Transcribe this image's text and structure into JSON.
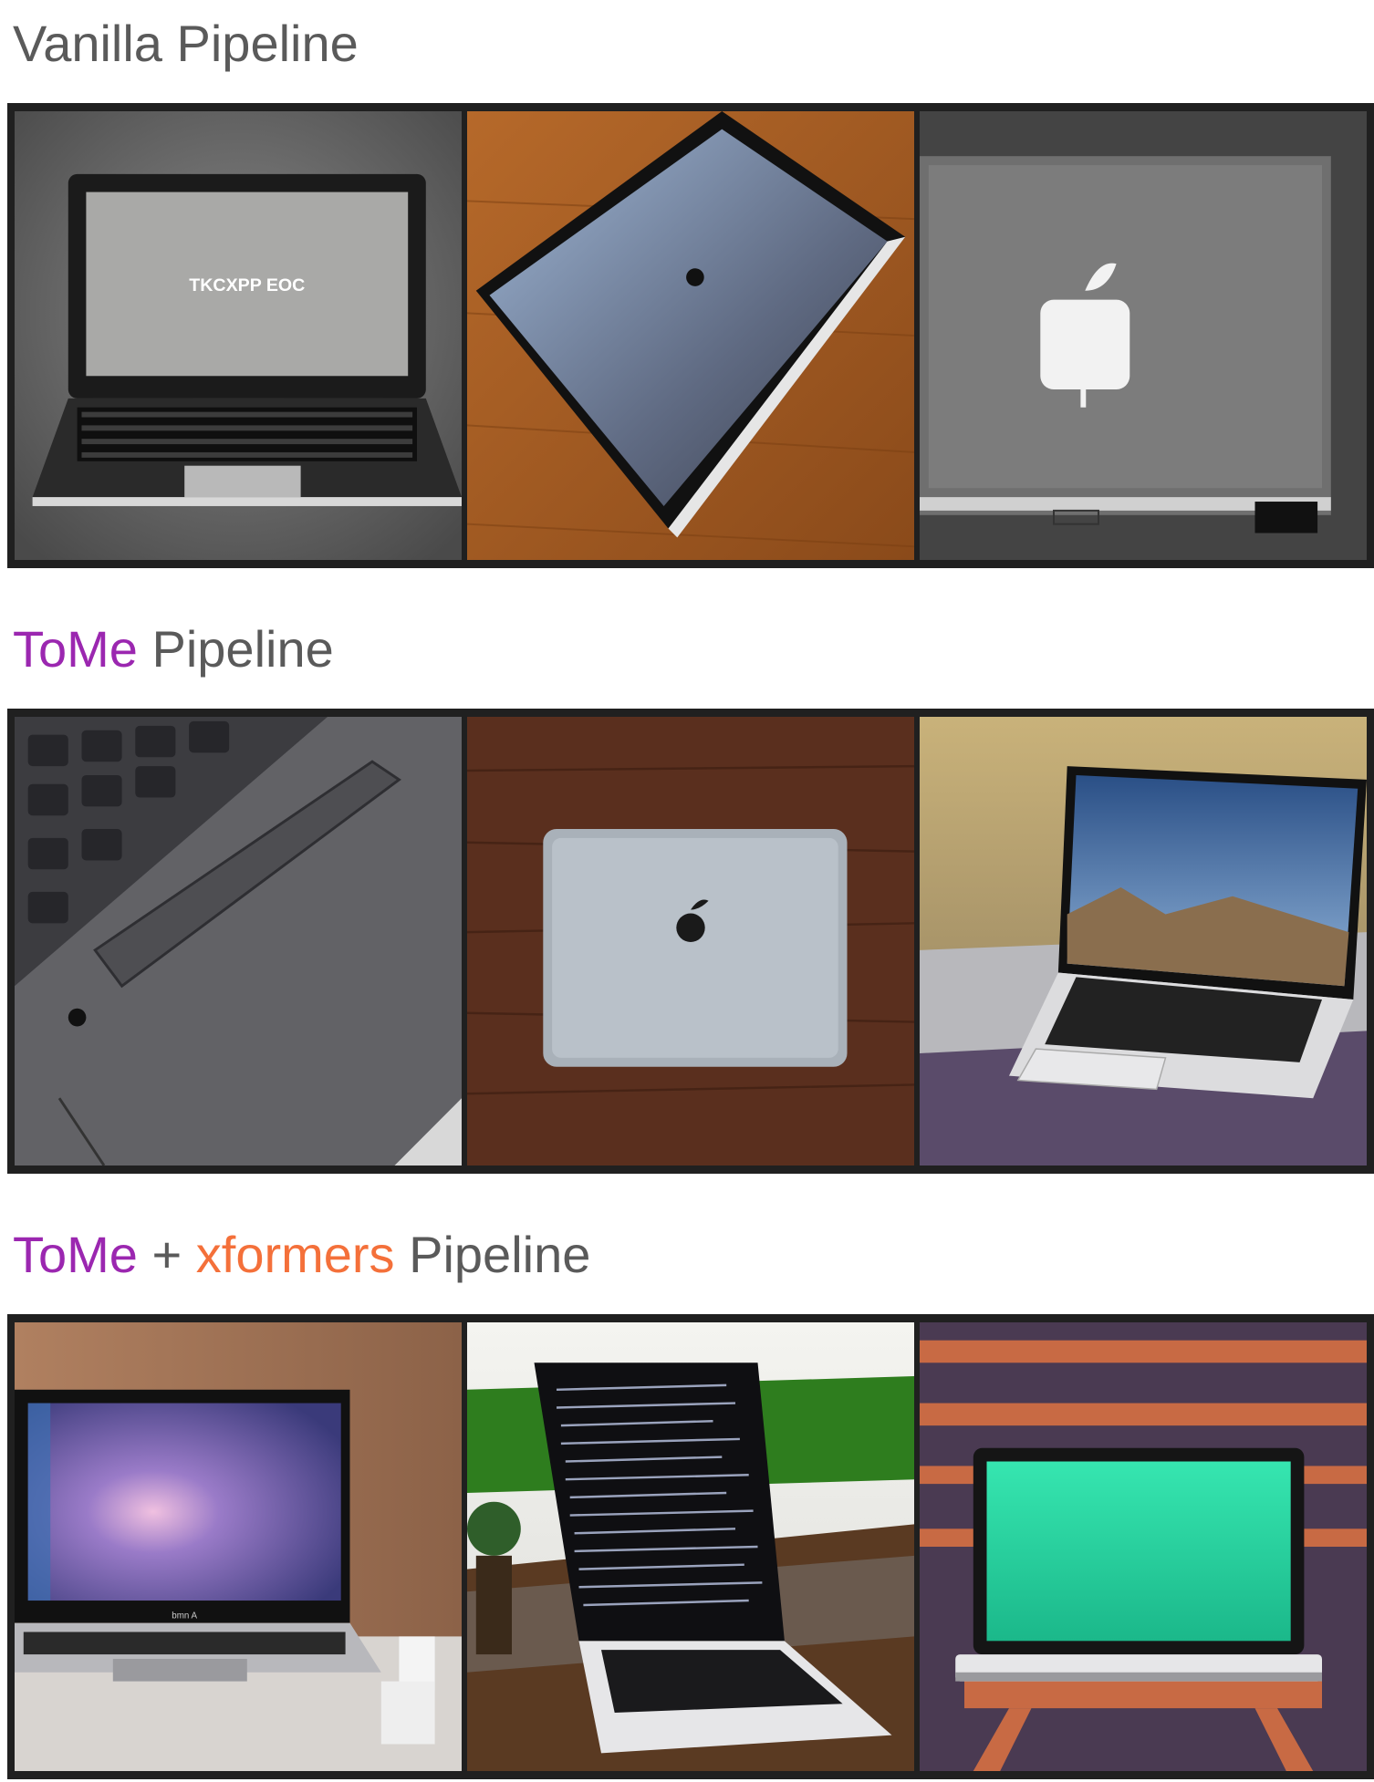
{
  "sections": [
    {
      "title_parts": [
        {
          "text": "Vanilla Pipeline",
          "color": "#5a5a5a"
        }
      ],
      "images": [
        {
          "subject": "black netbook on gray carpet",
          "screen_text": "TKCXPP EOC"
        },
        {
          "subject": "tablet laptop with apple logo on wooden floor"
        },
        {
          "subject": "gray laptop lid with white apple logo"
        }
      ]
    },
    {
      "title_parts": [
        {
          "text": "ToMe",
          "color": "#9b27b0"
        },
        {
          "text": " Pipeline",
          "color": "#5a5a5a"
        }
      ],
      "images": [
        {
          "subject": "closeup of gray laptop keyboard and trackpad"
        },
        {
          "subject": "silver macbook lid on dark wood"
        },
        {
          "subject": "open laptop showing mountain landscape"
        }
      ]
    },
    {
      "title_parts": [
        {
          "text": "ToMe",
          "color": "#9b27b0"
        },
        {
          "text": " + ",
          "color": "#5a5a5a"
        },
        {
          "text": "xformers",
          "color": "#f4703a"
        },
        {
          "text": " Pipeline",
          "color": "#5a5a5a"
        }
      ],
      "images": [
        {
          "subject": "laptop with galaxy wallpaper in front of wood wall",
          "screen_text": "bmn A"
        },
        {
          "subject": "laptop with code on screen on table outdoors"
        },
        {
          "subject": "laptop with green screen on wooden stool"
        }
      ]
    }
  ]
}
